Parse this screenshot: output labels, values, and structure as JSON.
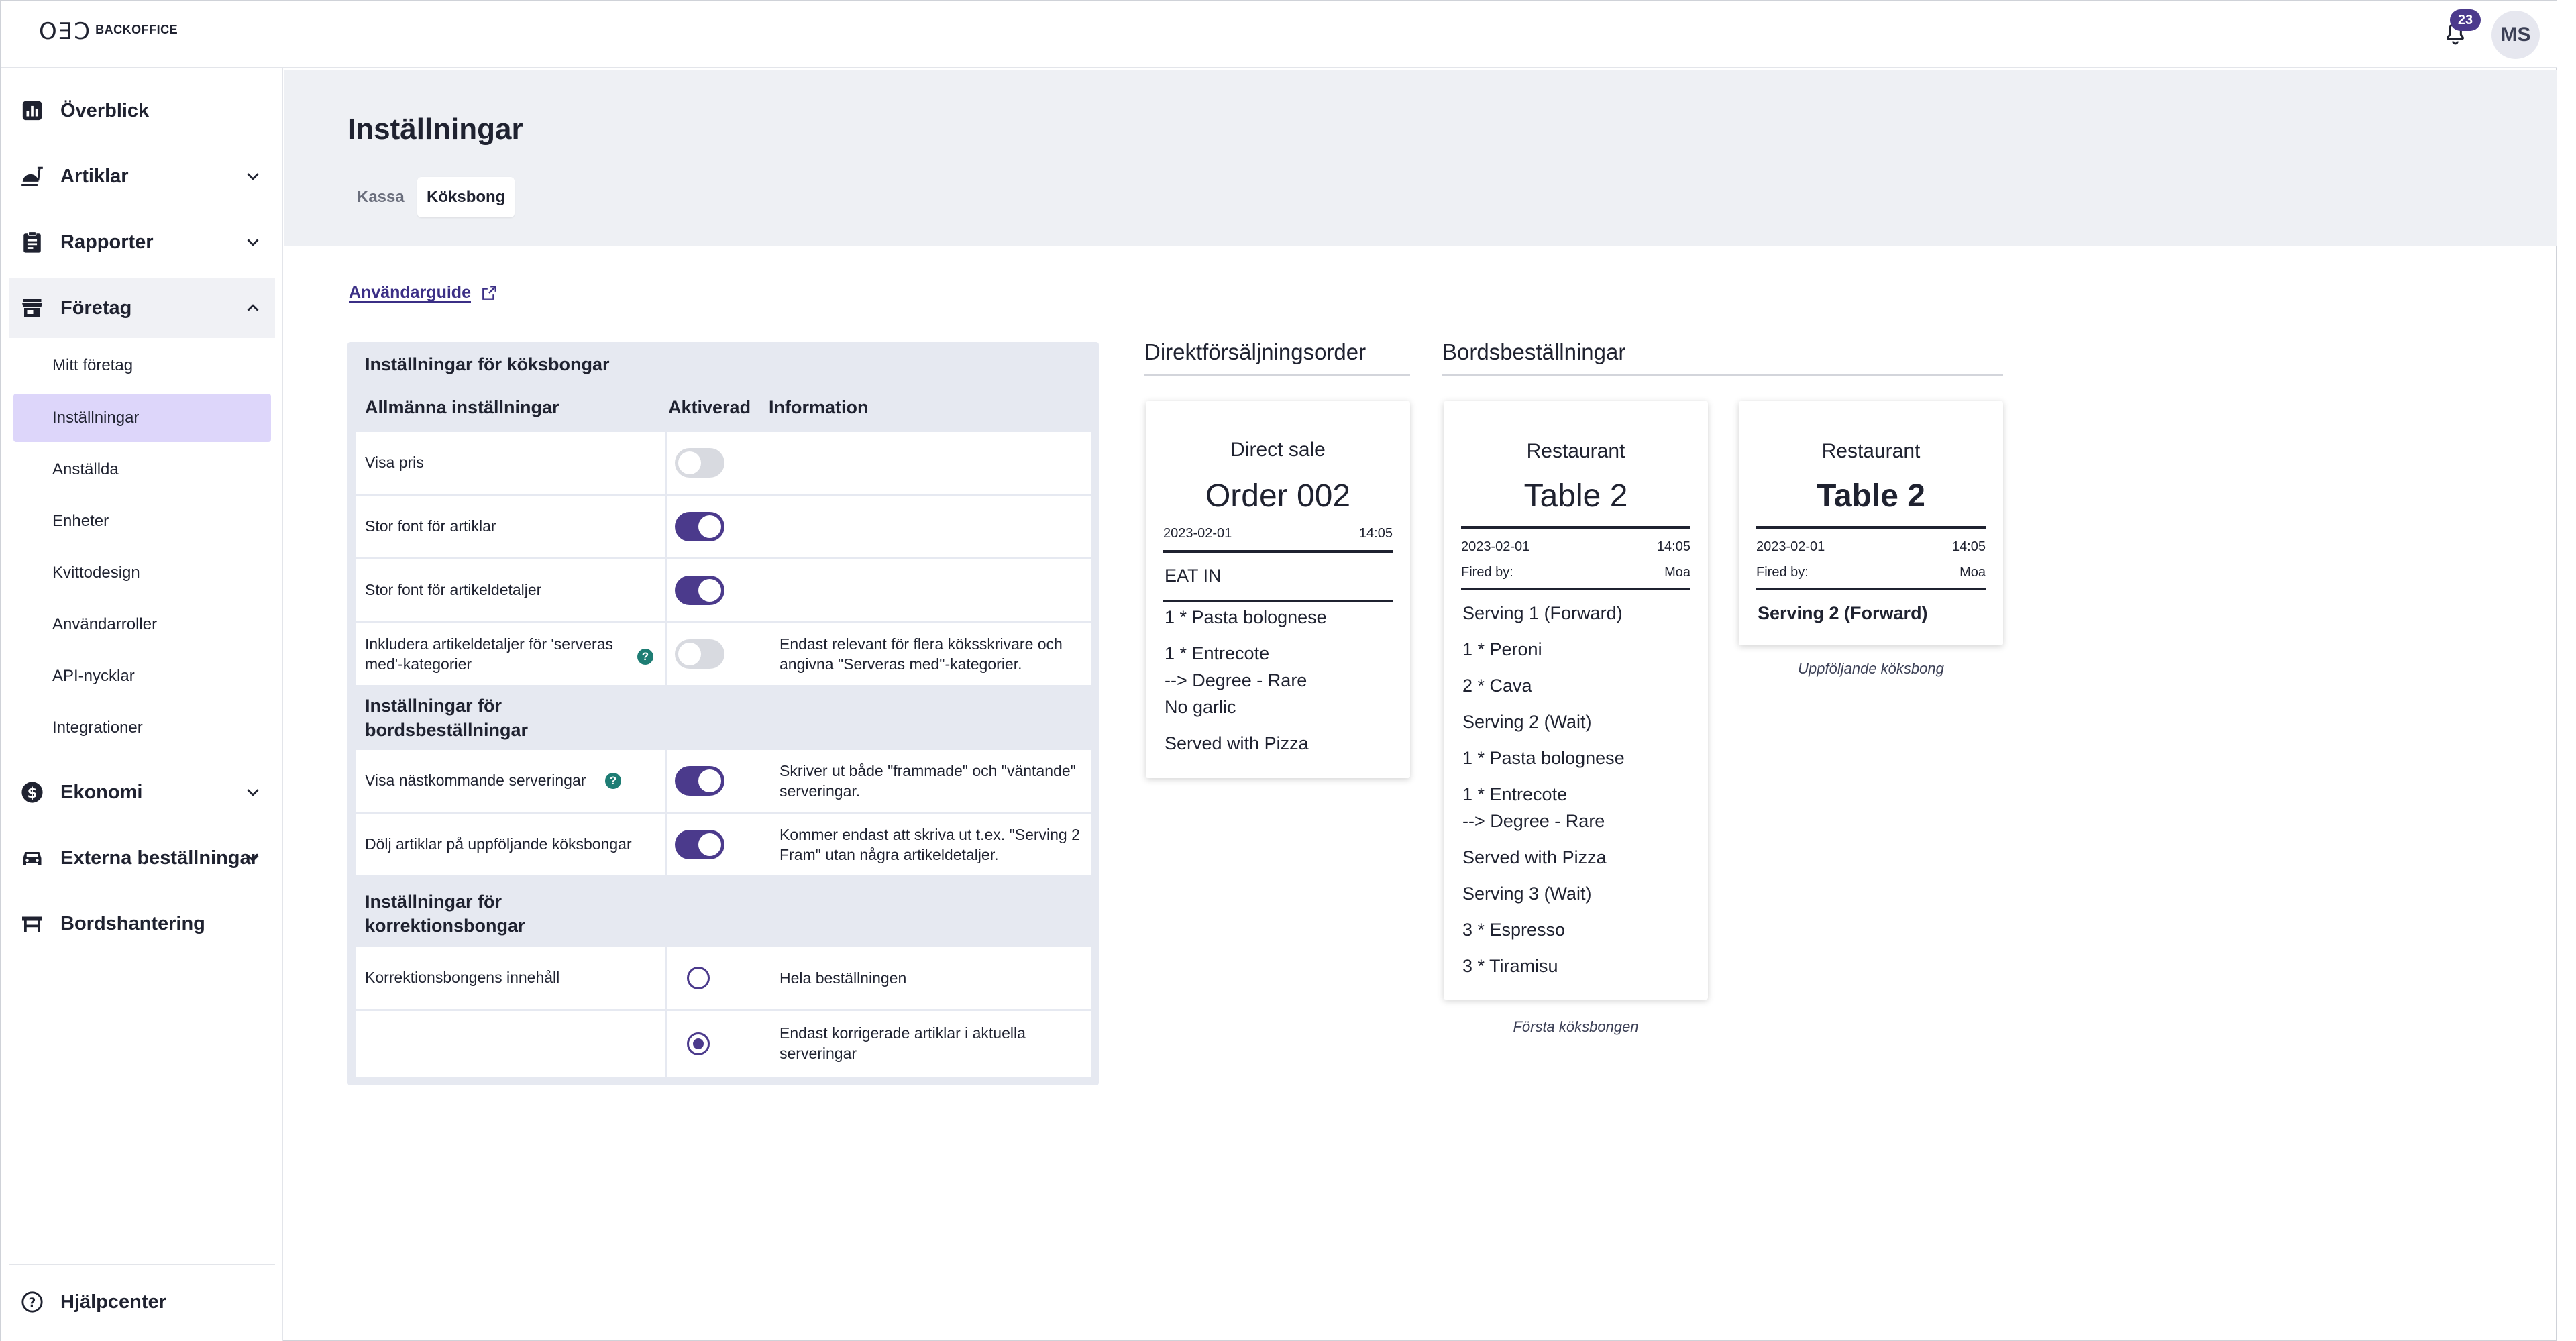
{
  "app": {
    "logo_mark": "OƎƆ",
    "logo_text": "BACKOFFICE",
    "notification_count": "23",
    "user_initials": "MS"
  },
  "sidebar": {
    "items": [
      {
        "label": "Överblick",
        "icon": "bar-chart-icon"
      },
      {
        "label": "Artiklar",
        "icon": "food-icon"
      },
      {
        "label": "Rapporter",
        "icon": "clipboard-icon"
      },
      {
        "label": "Företag",
        "icon": "store-icon"
      },
      {
        "label": "Ekonomi",
        "icon": "dollar-icon"
      },
      {
        "label": "Externa beställningar",
        "icon": "car-icon"
      },
      {
        "label": "Bordshantering",
        "icon": "table-icon"
      }
    ],
    "company_sub": [
      "Mitt företag",
      "Inställningar",
      "Anställda",
      "Enheter",
      "Kvittodesign",
      "Användarroller",
      "API-nycklar",
      "Integrationer"
    ],
    "help_label": "Hjälpcenter"
  },
  "page": {
    "title": "Inställningar",
    "tabs": [
      "Kassa",
      "Köksbong"
    ],
    "active_tab": "Köksbong",
    "guide_link": "Användarguide"
  },
  "settings": {
    "title": "Inställningar för köksbongar",
    "headers": {
      "general": "Allmänna inställningar",
      "enabled": "Aktiverad",
      "info": "Information"
    },
    "general_rows": [
      {
        "label": "Visa pris",
        "enabled": false,
        "info": ""
      },
      {
        "label": "Stor font för artiklar",
        "enabled": true,
        "info": ""
      },
      {
        "label": "Stor font för artikeldetaljer",
        "enabled": true,
        "info": ""
      },
      {
        "label": "Inkludera artikeldetaljer för 'serveras med'-kategorier",
        "enabled": false,
        "info": "Endast relevant för flera köksskrivare och angivna \"Serveras med\"-kategorier."
      }
    ],
    "table_section": "Inställningar för bordsbeställningar",
    "table_rows": [
      {
        "label": "Visa nästkommande serveringar",
        "enabled": true,
        "info": "Skriver ut både \"frammade\" och \"väntande\" serveringar."
      },
      {
        "label": "Dölj artiklar på uppföljande köksbongar",
        "enabled": true,
        "info": "Kommer endast att skriva ut t.ex. \"Serving 2 Fram\" utan några artikeldetaljer."
      }
    ],
    "correction_section": "Inställningar för korrektionsbongar",
    "correction_label": "Korrektionsbongens innehåll",
    "correction_options": [
      {
        "label": "Hela beställningen",
        "selected": false
      },
      {
        "label": "Endast korrigerade artiklar i aktuella serveringar",
        "selected": true
      }
    ]
  },
  "previews": {
    "direct_heading": "Direktförsäljningsorder",
    "table_heading": "Bordsbeställningar",
    "direct": {
      "subtitle": "Direct sale",
      "title": "Order 002",
      "date": "2023-02-01",
      "time": "14:05",
      "type": "EAT IN",
      "items": [
        "1 * Pasta bolognese",
        "1 * Entrecote",
        "--> Degree - Rare",
        "No garlic",
        "Served with Pizza"
      ]
    },
    "first": {
      "subtitle": "Restaurant",
      "title": "Table 2",
      "date": "2023-02-01",
      "time": "14:05",
      "fired_label": "Fired by:",
      "fired_by": "Moa",
      "items": [
        "Serving 1 (Forward)",
        "1 * Peroni",
        "2 * Cava",
        "Serving 2 (Wait)",
        "1 * Pasta bolognese",
        "1 * Entrecote",
        "--> Degree - Rare",
        "Served with Pizza",
        "Serving 3 (Wait)",
        "3 * Espresso",
        "3 * Tiramisu"
      ],
      "caption": "Första köksbongen"
    },
    "followup": {
      "subtitle": "Restaurant",
      "title": "Table 2",
      "date": "2023-02-01",
      "time": "14:05",
      "fired_label": "Fired by:",
      "fired_by": "Moa",
      "items": [
        "Serving 2 (Forward)"
      ],
      "caption": "Uppföljande köksbong"
    }
  },
  "colors": {
    "accent": "#4b3a8c",
    "active_nav": "#ddd6fa",
    "help_badge": "#1e7d74"
  }
}
